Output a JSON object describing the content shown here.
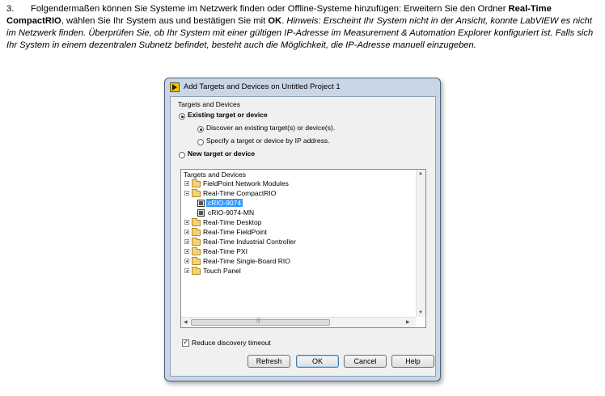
{
  "instruction": {
    "number": "3.",
    "part1": "Folgendermaßen können Sie Systeme im Netzwerk finden oder Offline-Systeme hinzufügen: Erweitern Sie den Ordner",
    "bold_folder": "Real-Time CompactRIO",
    "part2": ", wählen Sie Ihr System aus und bestätigen Sie mit",
    "bold_ok": "OK",
    "part3": ".",
    "hint": "Hinweis: Erscheint Ihr System nicht in der Ansicht, konnte LabVIEW es nicht im Netzwerk finden. Überprüfen Sie, ob Ihr System mit einer gültigen IP-Adresse im Measurement & Automation Explorer konfiguriert ist. Falls sich Ihr System in einem dezentralen Subnetz befindet, besteht auch die Möglichkeit, die IP-Adresse manuell einzugeben."
  },
  "dialog": {
    "title": "Add Targets and Devices on Untitled Project 1",
    "group_label": "Targets and Devices",
    "existing_label": "Existing target or device",
    "discover_label": "Discover an existing target(s) or device(s).",
    "specify_label": "Specify a target or device by IP address.",
    "new_label": "New target or device",
    "tree_header": "Targets and Devices",
    "tree_items": [
      {
        "label": "FieldPoint Network Modules",
        "kind": "folder",
        "expanded": false
      },
      {
        "label": "Real-Time CompactRIO",
        "kind": "folder",
        "expanded": true
      },
      {
        "label": "cRIO-9074",
        "kind": "device",
        "selected": true
      },
      {
        "label": "cRIO-9074-MN",
        "kind": "device",
        "selected": false
      },
      {
        "label": "Real-Time Desktop",
        "kind": "folder",
        "expanded": false
      },
      {
        "label": "Real-Time FieldPoint",
        "kind": "folder",
        "expanded": false
      },
      {
        "label": "Real-Time Industrial Controller",
        "kind": "folder",
        "expanded": false
      },
      {
        "label": "Real-Time PXI",
        "kind": "folder",
        "expanded": false
      },
      {
        "label": "Real-Time Single-Board RIO",
        "kind": "folder",
        "expanded": false
      },
      {
        "label": "Touch Panel",
        "kind": "folder",
        "expanded": false
      }
    ],
    "reduce_timeout_label": "Reduce discovery timeout",
    "reduce_timeout_checked": true,
    "buttons": {
      "refresh": "Refresh",
      "ok": "OK",
      "cancel": "Cancel",
      "help": "Help"
    },
    "icons": {
      "title": "labview-icon",
      "folder": "folder-icon",
      "device": "crio-device-icon"
    }
  }
}
